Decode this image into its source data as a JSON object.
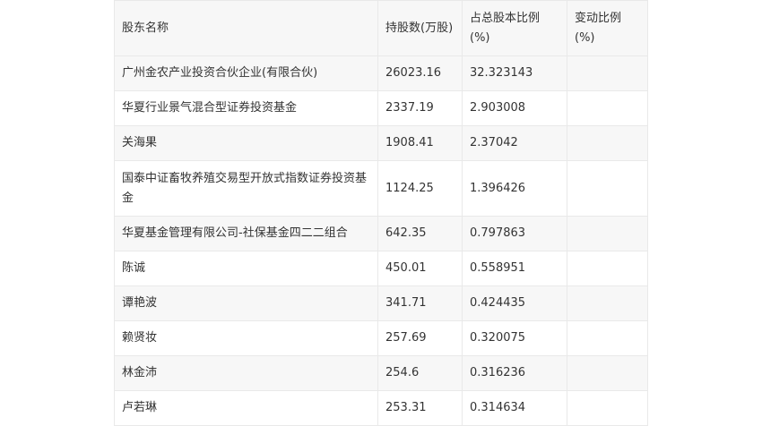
{
  "table": {
    "headers": [
      "股东名称",
      "持股数(万股)",
      "占总股本比例(%)",
      "变动比例(%)"
    ],
    "rows": [
      [
        "广州金农产业投资合伙企业(有限合伙)",
        "26023.16",
        "32.323143",
        ""
      ],
      [
        "华夏行业景气混合型证券投资基金",
        "2337.19",
        "2.903008",
        ""
      ],
      [
        "关海果",
        "1908.41",
        "2.37042",
        ""
      ],
      [
        "国泰中证畜牧养殖交易型开放式指数证券投资基金",
        "1124.25",
        "1.396426",
        ""
      ],
      [
        "华夏基金管理有限公司-社保基金四二二组合",
        "642.35",
        "0.797863",
        ""
      ],
      [
        "陈诚",
        "450.01",
        "0.558951",
        ""
      ],
      [
        "谭艳波",
        "341.71",
        "0.424435",
        ""
      ],
      [
        "赖贤妆",
        "257.69",
        "0.320075",
        ""
      ],
      [
        "林金沛",
        "254.6",
        "0.316236",
        ""
      ],
      [
        "卢若琳",
        "253.31",
        "0.314634",
        ""
      ]
    ]
  }
}
